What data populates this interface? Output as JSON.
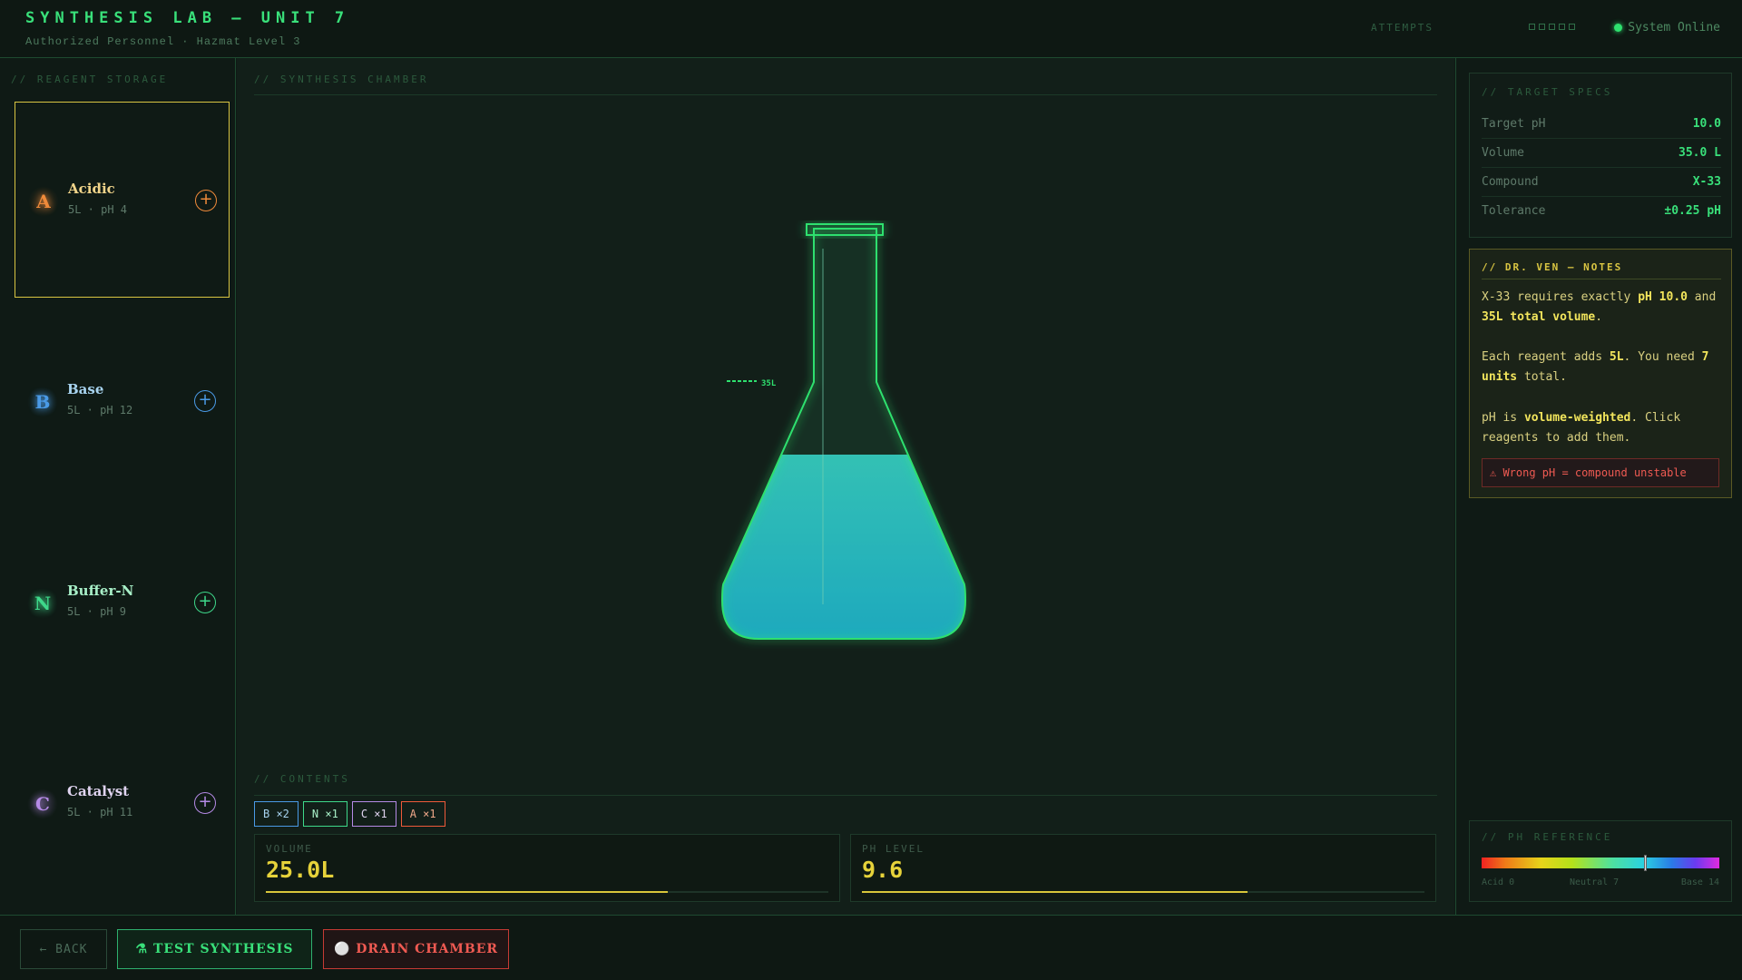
{
  "header": {
    "title": "SYNTHESIS LAB — UNIT 7",
    "subtitle": "Authorized Personnel · Hazmat Level 3",
    "attempts_label": "ATTEMPTS",
    "attempts_total": 5,
    "status_text": "System Online"
  },
  "sidebar": {
    "title": "// REAGENT STORAGE",
    "reagents": [
      {
        "letter": "A",
        "name": "Acidic",
        "meta": "5L · pH 4",
        "color": "#ef8a3a",
        "name_color": "#f0d48a",
        "selected": true
      },
      {
        "letter": "B",
        "name": "Base",
        "meta": "5L · pH 12",
        "color": "#4a9ae6",
        "name_color": "#a8d4f0",
        "selected": false
      },
      {
        "letter": "N",
        "name": "Buffer-N",
        "meta": "5L · pH 9",
        "color": "#3ed88a",
        "name_color": "#a8f0c8",
        "selected": false
      },
      {
        "letter": "C",
        "name": "Catalyst",
        "meta": "5L · pH 11",
        "color": "#b58ae6",
        "name_color": "#e0d4f0",
        "selected": false
      }
    ]
  },
  "chamber": {
    "title": "// SYNTHESIS CHAMBER",
    "target_mark_label": "35L",
    "liquid_color": "#2ad2d8",
    "contents_title": "// CONTENTS",
    "chips": [
      {
        "label": "B ×2",
        "color": "#4a9ae6",
        "text_color": "#a8d4f0"
      },
      {
        "label": "N ×1",
        "color": "#3ed88a",
        "text_color": "#a8f0c8"
      },
      {
        "label": "C ×1",
        "color": "#b58ae6",
        "text_color": "#e0d4f0"
      },
      {
        "label": "A ×1",
        "color": "#ef5a3a",
        "text_color": "#f0a88a"
      }
    ],
    "volume": {
      "label": "VOLUME",
      "value": "25.0L",
      "fraction": 0.714
    },
    "ph": {
      "label": "PH LEVEL",
      "value": "9.6",
      "fraction": 0.686
    }
  },
  "specs": {
    "title": "// TARGET SPECS",
    "rows": [
      {
        "key": "Target pH",
        "value": "10.0"
      },
      {
        "key": "Volume",
        "value": "35.0 L"
      },
      {
        "key": "Compound",
        "value": "X-33"
      },
      {
        "key": "Tolerance",
        "value": "±0.25 pH"
      }
    ]
  },
  "notes": {
    "title": "// DR. VEN — NOTES",
    "p1": [
      "X-33 requires exactly ",
      "pH 10.0",
      " and ",
      "35L total volume",
      "."
    ],
    "p2": [
      "Each reagent adds ",
      "5L",
      ". You need ",
      "7 units",
      " total."
    ],
    "p3": [
      "pH is ",
      "volume-weighted",
      ". Click reagents to add them."
    ],
    "warning": "⚠ Wrong pH = compound unstable"
  },
  "ph_reference": {
    "title": "// PH REFERENCE",
    "marker_ph": 9.6,
    "ticks": [
      "Acid 0",
      "Neutral 7",
      "Base 14"
    ]
  },
  "footer": {
    "back_label": "← BACK",
    "test_label": "⚗ TEST SYNTHESIS",
    "drain_label": "⚪ DRAIN CHAMBER"
  }
}
